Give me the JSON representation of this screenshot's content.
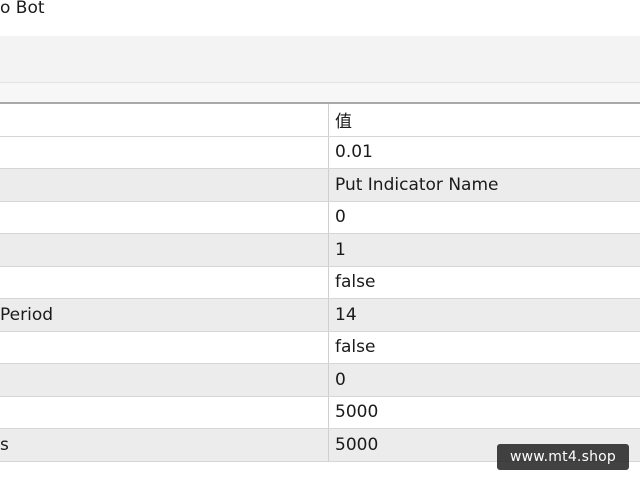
{
  "window": {
    "title": "o Bot"
  },
  "table": {
    "header": {
      "name": "",
      "value": "值"
    },
    "rows": [
      {
        "name": "",
        "value": "0.01"
      },
      {
        "name": "",
        "value": "Put Indicator Name"
      },
      {
        "name": "",
        "value": "0"
      },
      {
        "name": "",
        "value": "1"
      },
      {
        "name": "",
        "value": "false"
      },
      {
        "name": "Period",
        "value": "14"
      },
      {
        "name": "",
        "value": "false"
      },
      {
        "name": "",
        "value": "0"
      },
      {
        "name": "",
        "value": "5000"
      },
      {
        "name": "s",
        "value": "5000"
      }
    ]
  },
  "watermark": {
    "text": "www.mt4.shop"
  }
}
